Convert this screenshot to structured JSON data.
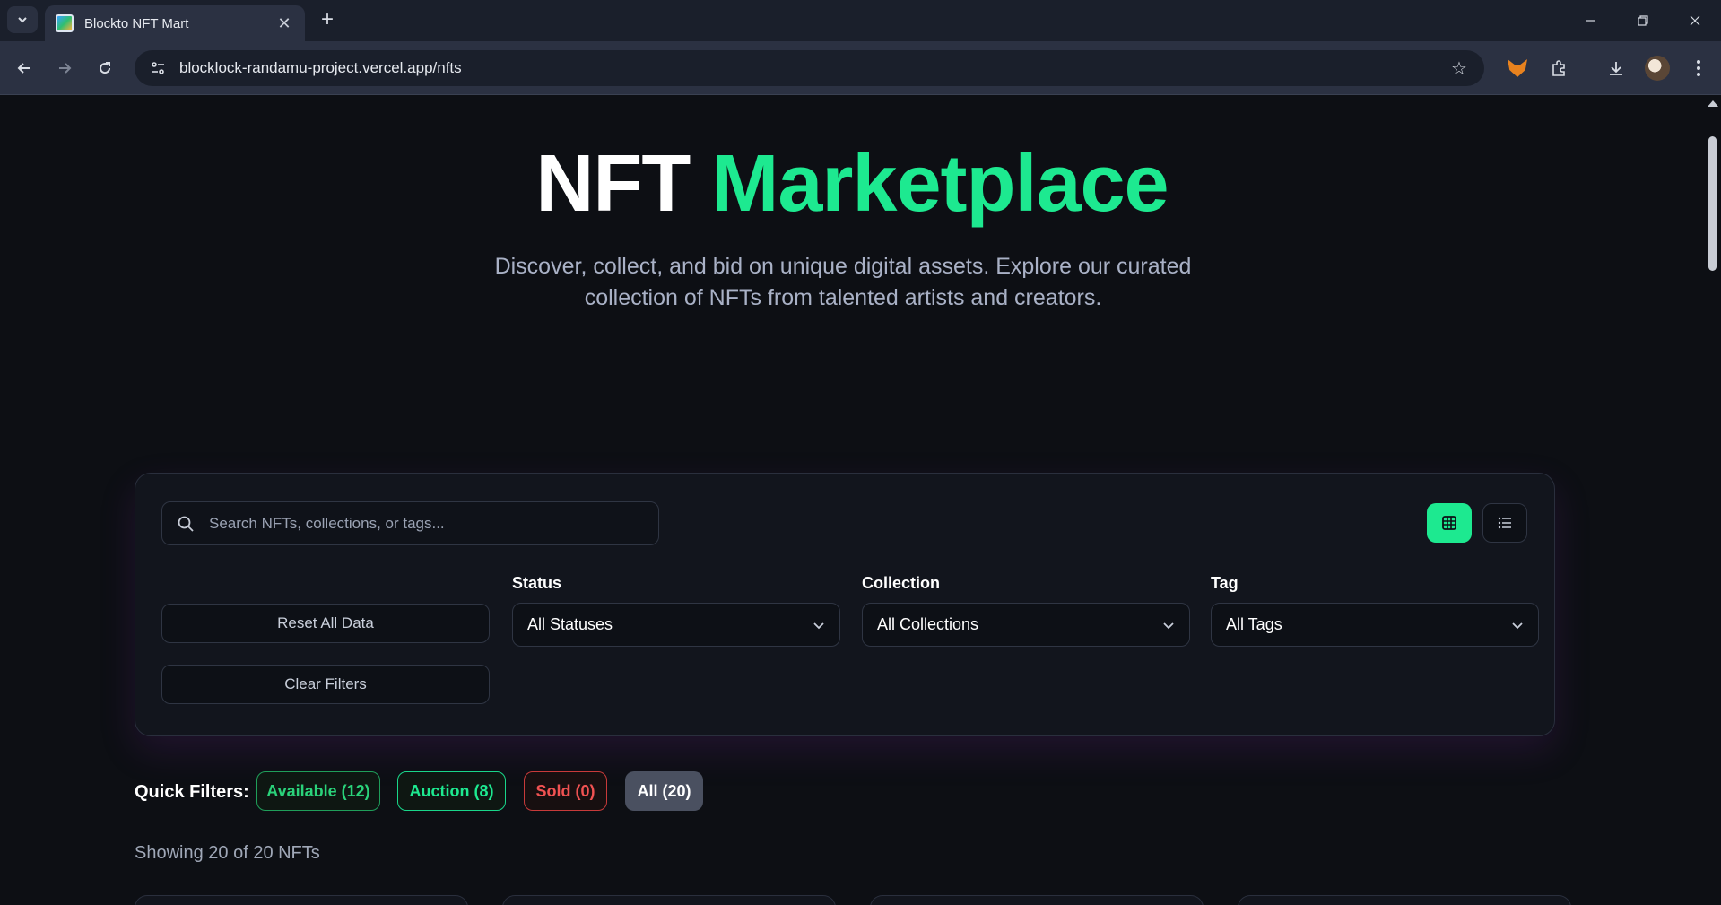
{
  "browser": {
    "tab_title": "Blockto NFT Mart",
    "url": "blocklock-randamu-project.vercel.app/nfts"
  },
  "hero": {
    "title_main": "NFT",
    "title_accent": "Marketplace",
    "subtitle": "Discover, collect, and bid on unique digital assets. Explore our curated collection of NFTs from talented artists and creators."
  },
  "filters": {
    "search_placeholder": "Search NFTs, collections, or tags...",
    "reset_label": "Reset All Data",
    "clear_label": "Clear Filters",
    "status": {
      "label": "Status",
      "value": "All Statuses"
    },
    "collection": {
      "label": "Collection",
      "value": "All Collections"
    },
    "tag": {
      "label": "Tag",
      "value": "All Tags"
    },
    "active_view": "grid"
  },
  "quick_filters": {
    "label": "Quick Filters:",
    "available": "Available (12)",
    "auction": "Auction (8)",
    "sold": "Sold (0)",
    "all": "All (20)"
  },
  "results": {
    "showing": "Showing 20 of 20 NFTs"
  },
  "colors": {
    "accent": "#1de990",
    "background": "#0d0f14",
    "sold": "#f05252"
  }
}
